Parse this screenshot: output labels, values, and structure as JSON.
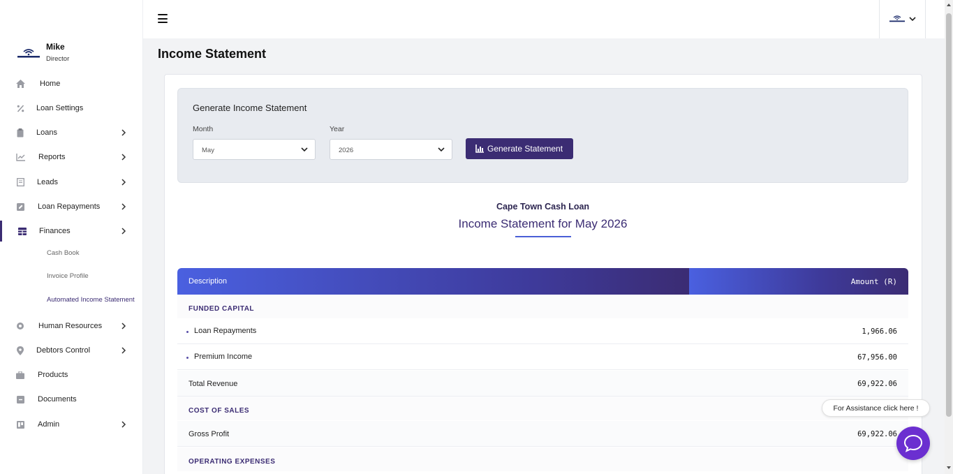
{
  "user": {
    "name": "Mike",
    "role": "Director"
  },
  "sidebar": {
    "items": [
      {
        "label": "Home",
        "icon": "home-icon"
      },
      {
        "label": "Loan Settings",
        "icon": "percent-icon"
      },
      {
        "label": "Loans",
        "icon": "clipboard-icon"
      },
      {
        "label": "Reports",
        "icon": "chart-line-icon"
      },
      {
        "label": "Leads",
        "icon": "file-icon"
      },
      {
        "label": "Loan Repayments",
        "icon": "edit-icon"
      },
      {
        "label": "Finances",
        "icon": "table-icon"
      },
      {
        "label": "Human Resources",
        "icon": "circle-icon"
      },
      {
        "label": "Debtors Control",
        "icon": "map-pin-icon"
      },
      {
        "label": "Products",
        "icon": "briefcase-icon"
      },
      {
        "label": "Documents",
        "icon": "minus-square-icon"
      },
      {
        "label": "Admin",
        "icon": "trello-icon"
      }
    ],
    "finances_sub": [
      {
        "label": "Cash Book"
      },
      {
        "label": "Invoice Profile"
      },
      {
        "label": "Automated Income Statement"
      }
    ]
  },
  "page": {
    "title": "Income Statement"
  },
  "generator": {
    "title": "Generate Income Statement",
    "month_label": "Month",
    "month_value": "May",
    "year_label": "Year",
    "year_value": "2026",
    "button_label": "Generate Statement"
  },
  "statement": {
    "company": "Cape Town Cash Loan",
    "title": "Income Statement for May 2026",
    "columns": {
      "description": "Description",
      "amount": "Amount (R)"
    },
    "funded_capital": "FUNDED CAPITAL",
    "loan_repayments": {
      "label": "Loan Repayments",
      "amount": "1,966.06"
    },
    "premium_income": {
      "label": "Premium Income",
      "amount": "67,956.00"
    },
    "total_revenue": {
      "label": "Total Revenue",
      "amount": "69,922.06"
    },
    "cost_of_sales": "COST OF SALES",
    "gross_profit": {
      "label": "Gross Profit",
      "amount": "69,922.06"
    },
    "operating_expenses": "OPERATING EXPENSES"
  },
  "assist": {
    "label": "For Assistance click here !"
  },
  "colors": {
    "brand": "#3b2c73",
    "accent": "#4a60e0",
    "chat": "#6b2fd0"
  }
}
